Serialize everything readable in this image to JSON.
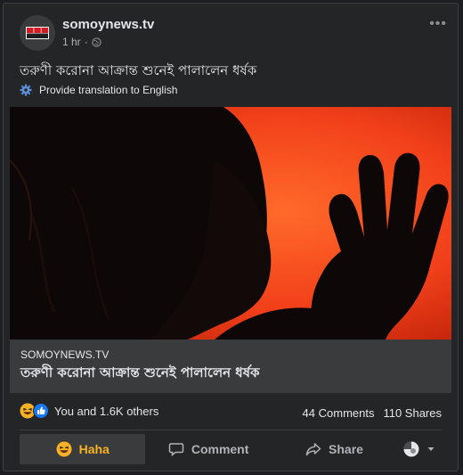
{
  "post": {
    "page_name": "somoynews.tv",
    "time": "1 hr",
    "text": "তরুণী করোনা আক্রান্ত শুনেই পালালেন ধর্ষক",
    "translate_label": "Provide translation to English",
    "logo_text": "সময়"
  },
  "link_preview": {
    "domain": "SOMOYNEWS.TV",
    "title": "তরুণী করোনা আক্রান্ত শুনেই পালালেন ধর্ষক"
  },
  "stats": {
    "reactions": "You and 1.6K others",
    "comments": "44 Comments",
    "shares": "110 Shares"
  },
  "actions": {
    "haha": "Haha",
    "comment": "Comment",
    "share": "Share"
  },
  "colors": {
    "accent_haha": "#f7b125",
    "like_blue": "#1877f2",
    "image_bg": "#ff4a1a"
  }
}
